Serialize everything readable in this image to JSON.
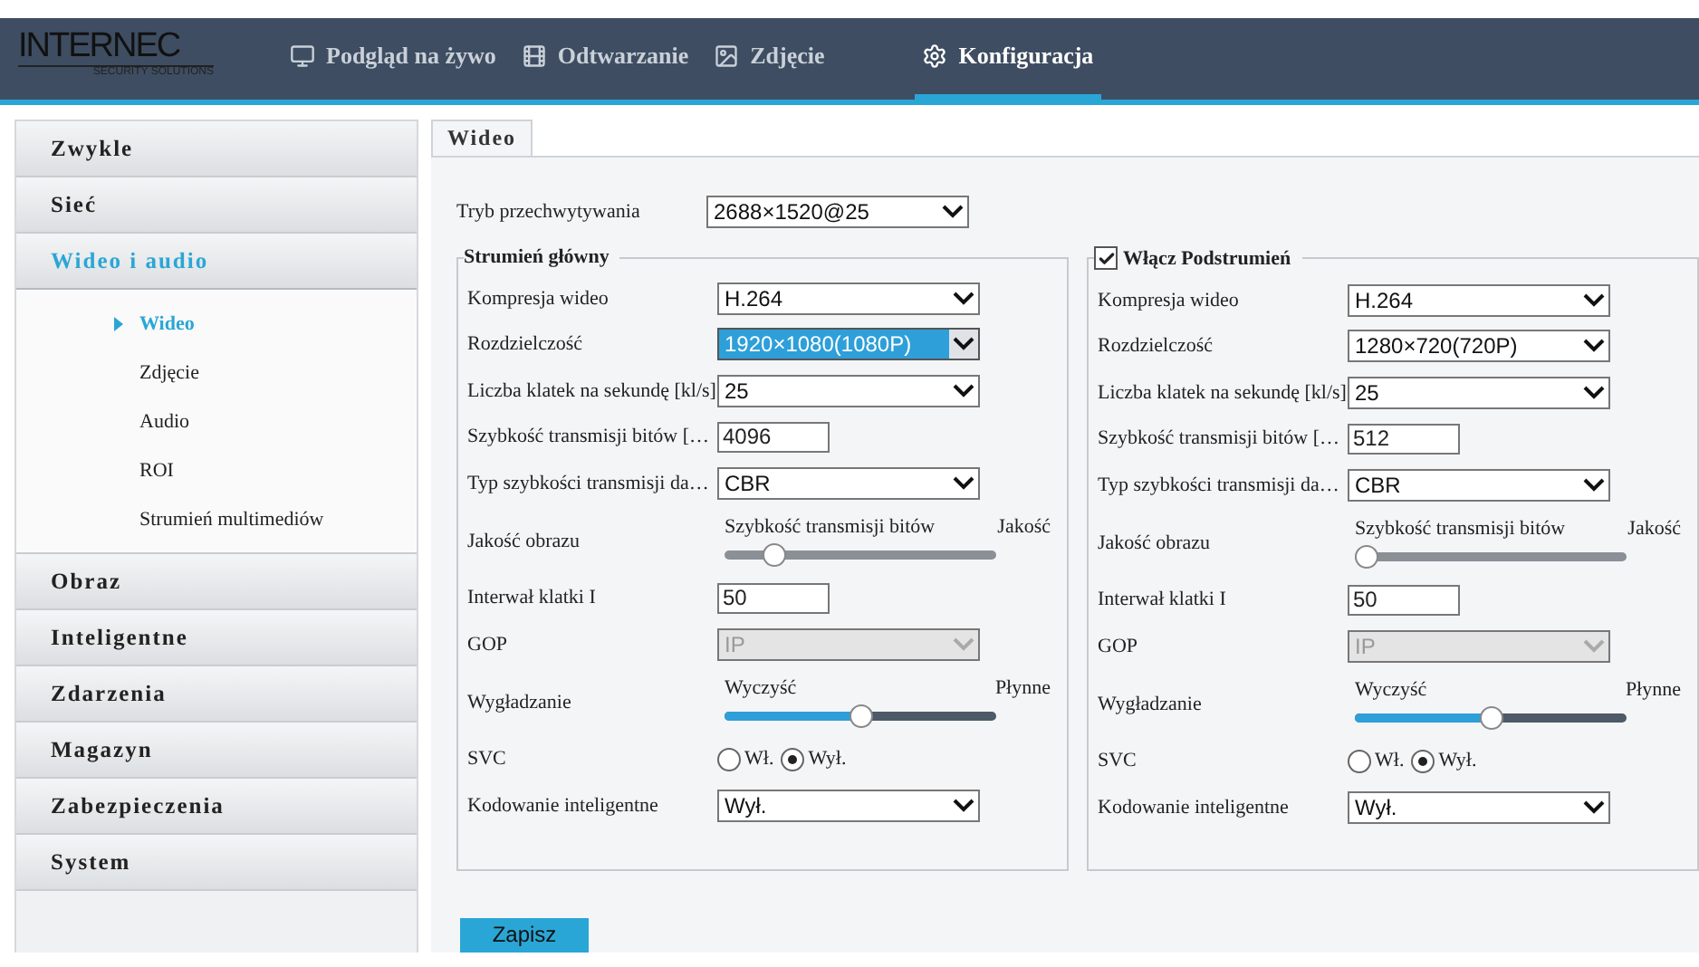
{
  "header": {
    "logo": {
      "name": "INTERNEC",
      "tagline": "SECURITY SOLUTIONS"
    },
    "nav": [
      {
        "kind": "monitor",
        "label": "Podgląd na żywo",
        "selected": false
      },
      {
        "kind": "film",
        "label": "Odtwarzanie",
        "selected": false
      },
      {
        "kind": "image",
        "label": "Zdjęcie",
        "selected": false
      },
      {
        "kind": "gear",
        "label": "Konfiguracja",
        "selected": true
      }
    ]
  },
  "sidebar": {
    "items": [
      {
        "label": "Zwykle",
        "selected": false,
        "expanded": false
      },
      {
        "label": "Sieć",
        "selected": false,
        "expanded": false
      },
      {
        "label": "Wideo i audio",
        "selected": true,
        "expanded": true,
        "children": [
          {
            "label": "Wideo",
            "selected": true
          },
          {
            "label": "Zdjęcie",
            "selected": false
          },
          {
            "label": "Audio",
            "selected": false
          },
          {
            "label": "ROI",
            "selected": false
          },
          {
            "label": "Strumień multimediów",
            "selected": false
          }
        ]
      },
      {
        "label": "Obraz",
        "selected": false,
        "expanded": false
      },
      {
        "label": "Inteligentne",
        "selected": false,
        "expanded": false
      },
      {
        "label": "Zdarzenia",
        "selected": false,
        "expanded": false
      },
      {
        "label": "Magazyn",
        "selected": false,
        "expanded": false
      },
      {
        "label": "Zabezpieczenia",
        "selected": false,
        "expanded": false
      },
      {
        "label": "System",
        "selected": false,
        "expanded": false
      }
    ]
  },
  "tabs": [
    {
      "label": "Wideo",
      "selected": true
    }
  ],
  "capture_mode": {
    "label": "Tryb przechwytywania",
    "value": "2688×1520@25"
  },
  "streams": [
    {
      "kind": "plain",
      "title": "Strumień główny",
      "rows": [
        {
          "kind": "select",
          "label": "Kompresja wideo",
          "value": "H.264",
          "highlighted": false,
          "disabled": false
        },
        {
          "kind": "select",
          "label": "Rozdzielczość",
          "value": "1920×1080(1080P)",
          "highlighted": true,
          "disabled": false
        },
        {
          "kind": "select",
          "label": "Liczba klatek na sekundę [kl/s]",
          "value": "25",
          "highlighted": false,
          "disabled": false
        },
        {
          "kind": "input",
          "label": "Szybkość transmisji bitów […",
          "value": "4096"
        },
        {
          "kind": "select",
          "label": "Typ szybkości transmisji da…",
          "value": "CBR",
          "highlighted": false,
          "disabled": false
        },
        {
          "kind": "slider",
          "label": "Jakość obrazu",
          "left_label": "Szybkość transmisji bitów",
          "right_label": "Jakość",
          "level": 0.15,
          "filled": false
        },
        {
          "kind": "input",
          "label": "Interwał klatki I",
          "value": "50"
        },
        {
          "kind": "select",
          "label": "GOP",
          "value": "IP",
          "highlighted": false,
          "disabled": true
        },
        {
          "kind": "slider",
          "label": "Wygładzanie",
          "left_label": "Wyczyść",
          "right_label": "Płynne",
          "level": 0.5,
          "filled": true
        },
        {
          "kind": "radio",
          "label": "SVC",
          "options": [
            {
              "label": "Wł.",
              "selected": false
            },
            {
              "label": "Wył.",
              "selected": true
            }
          ]
        },
        {
          "kind": "select",
          "label": "Kodowanie inteligentne",
          "value": "Wył.",
          "highlighted": false,
          "disabled": false
        }
      ]
    },
    {
      "kind": "checkbox",
      "title": "Włącz Podstrumień",
      "checked": true,
      "rows": [
        {
          "kind": "select",
          "label": "Kompresja wideo",
          "value": "H.264",
          "highlighted": false,
          "disabled": false
        },
        {
          "kind": "select",
          "label": "Rozdzielczość",
          "value": "1280×720(720P)",
          "highlighted": false,
          "disabled": false
        },
        {
          "kind": "select",
          "label": "Liczba klatek na sekundę [kl/s]",
          "value": "25",
          "highlighted": false,
          "disabled": false
        },
        {
          "kind": "input",
          "label": "Szybkość transmisji bitów […",
          "value": "512"
        },
        {
          "kind": "select",
          "label": "Typ szybkości transmisji da…",
          "value": "CBR",
          "highlighted": false,
          "disabled": false
        },
        {
          "kind": "slider",
          "label": "Jakość obrazu",
          "left_label": "Szybkość transmisji bitów",
          "right_label": "Jakość",
          "level": 0,
          "filled": false
        },
        {
          "kind": "input",
          "label": "Interwał klatki I",
          "value": "50"
        },
        {
          "kind": "select",
          "label": "GOP",
          "value": "IP",
          "highlighted": false,
          "disabled": true
        },
        {
          "kind": "slider",
          "label": "Wygładzanie",
          "left_label": "Wyczyść",
          "right_label": "Płynne",
          "level": 0.5,
          "filled": true
        },
        {
          "kind": "radio",
          "label": "SVC",
          "options": [
            {
              "label": "Wł.",
              "selected": false
            },
            {
              "label": "Wył.",
              "selected": true
            }
          ]
        },
        {
          "kind": "select",
          "label": "Kodowanie inteligentne",
          "value": "Wył.",
          "highlighted": false,
          "disabled": false
        }
      ]
    }
  ],
  "save_button": "Zapisz"
}
